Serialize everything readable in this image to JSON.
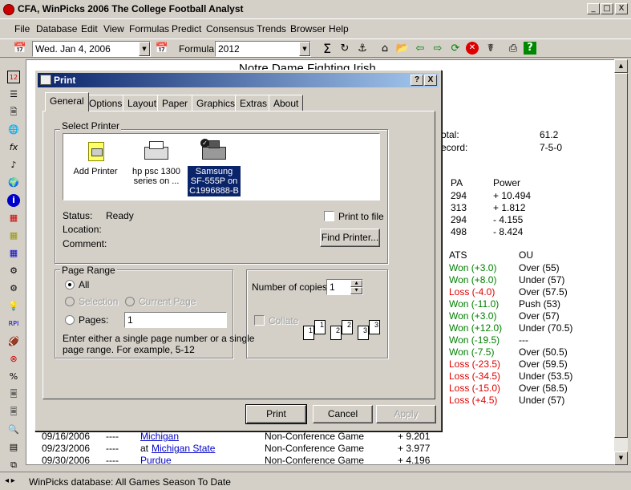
{
  "app": {
    "title": "CFA, WinPicks 2006 The College Football Analyst",
    "min_label": "_",
    "max_label": "□",
    "close_label": "X"
  },
  "menu": {
    "items": [
      "File",
      "Database",
      "Edit",
      "View",
      "Formulas",
      "Predict",
      "Consensus",
      "Trends",
      "Browser",
      "Help"
    ]
  },
  "toolbar": {
    "date_value": "Wed.  Jan  4, 2006",
    "formula_label": "Formula",
    "formula_value": "2012"
  },
  "document": {
    "title": "Notre Dame Fighting Irish",
    "summary": [
      {
        "label": "otal:",
        "value": "61.2"
      },
      {
        "label": "ecord:",
        "value": "7-5-0"
      }
    ],
    "pa_headers": {
      "pa": "PA",
      "power": "Power"
    },
    "pa_rows": [
      {
        "pa": "294",
        "power": "+ 10.494"
      },
      {
        "pa": "313",
        "power": "+ 1.812"
      },
      {
        "pa": "294",
        "power": "- 4.155"
      },
      {
        "pa": "498",
        "power": "- 8.424"
      }
    ],
    "ats_headers": {
      "ats": "ATS",
      "ou": "OU"
    },
    "ats_rows": [
      {
        "ats": "Won (+3.0)",
        "result": "won",
        "ou": "Over (55)"
      },
      {
        "ats": "Won (+8.0)",
        "result": "won",
        "ou": "Under (57)"
      },
      {
        "ats": "Loss (-4.0)",
        "result": "loss",
        "ou": "Over (57.5)"
      },
      {
        "ats": "Won (-11.0)",
        "result": "won",
        "ou": "Push (53)"
      },
      {
        "ats": "Won (+3.0)",
        "result": "won",
        "ou": "Over (57)"
      },
      {
        "ats": "Won (+12.0)",
        "result": "won",
        "ou": "Under (70.5)"
      },
      {
        "ats": "Won (-19.5)",
        "result": "won",
        "ou": "---"
      },
      {
        "ats": "Won (-7.5)",
        "result": "won",
        "ou": "Over (50.5)"
      },
      {
        "ats": "Loss (-23.5)",
        "result": "loss",
        "ou": "Over (59.5)"
      },
      {
        "ats": "Loss (-34.5)",
        "result": "loss",
        "ou": "Under (53.5)"
      },
      {
        "ats": "Loss (-15.0)",
        "result": "loss",
        "ou": "Over (58.5)"
      },
      {
        "ats": "Loss (+4.5)",
        "result": "loss",
        "ou": "Under (57)"
      }
    ],
    "schedule": [
      {
        "date": "09/16/2006",
        "dash": "----",
        "prefix": "",
        "team": "Michigan",
        "type": "Non-Conference Game",
        "power": "+ 9.201"
      },
      {
        "date": "09/23/2006",
        "dash": "----",
        "prefix": "at",
        "team": "Michigan State",
        "type": "Non-Conference Game",
        "power": "+ 3.977"
      },
      {
        "date": "09/30/2006",
        "dash": "----",
        "prefix": "",
        "team": "Purdue",
        "type": "Non-Conference Game",
        "power": "+ 4.196"
      }
    ]
  },
  "status": {
    "text": "WinPicks database:  All Games Season To Date"
  },
  "print_dialog": {
    "title": "Print",
    "help_label": "?",
    "close_label": "X",
    "tabs": [
      "General",
      "Options",
      "Layout",
      "Paper",
      "Graphics",
      "Extras",
      "About"
    ],
    "select_printer_label": "Select Printer",
    "printers": [
      {
        "line1": "Add Printer",
        "line2": "",
        "line3": "",
        "icon": "add-printer-icon"
      },
      {
        "line1": "hp psc 1300",
        "line2": "series on ...",
        "line3": "",
        "icon": "printer-icon"
      },
      {
        "line1": "Samsung",
        "line2": "SF-555P on",
        "line3": "C1996888-B",
        "icon": "default-printer-icon"
      }
    ],
    "status_label": "Status:",
    "status_value": "Ready",
    "location_label": "Location:",
    "location_value": "",
    "comment_label": "Comment:",
    "comment_value": "",
    "print_to_file_label": "Print to file",
    "find_printer_label": "Find Printer...",
    "page_range_label": "Page Range",
    "all_label": "All",
    "selection_label": "Selection",
    "current_page_label": "Current Page",
    "pages_label": "Pages:",
    "pages_value": "1",
    "page_hint_line1": "Enter either a single page number or a single",
    "page_hint_line2": "page range.  For example, 5-12",
    "copies_label": "Number of copies:",
    "copies_value": "1",
    "collate_label": "Collate",
    "collate_pages": [
      "1",
      "1",
      "2",
      "2",
      "3",
      "3"
    ],
    "print_button": "Print",
    "cancel_button": "Cancel",
    "apply_button": "Apply"
  },
  "colors": {
    "won": "#008000",
    "loss": "#e00000",
    "dialog_title_start": "#0a246a",
    "dialog_title_end": "#a6caf0"
  }
}
